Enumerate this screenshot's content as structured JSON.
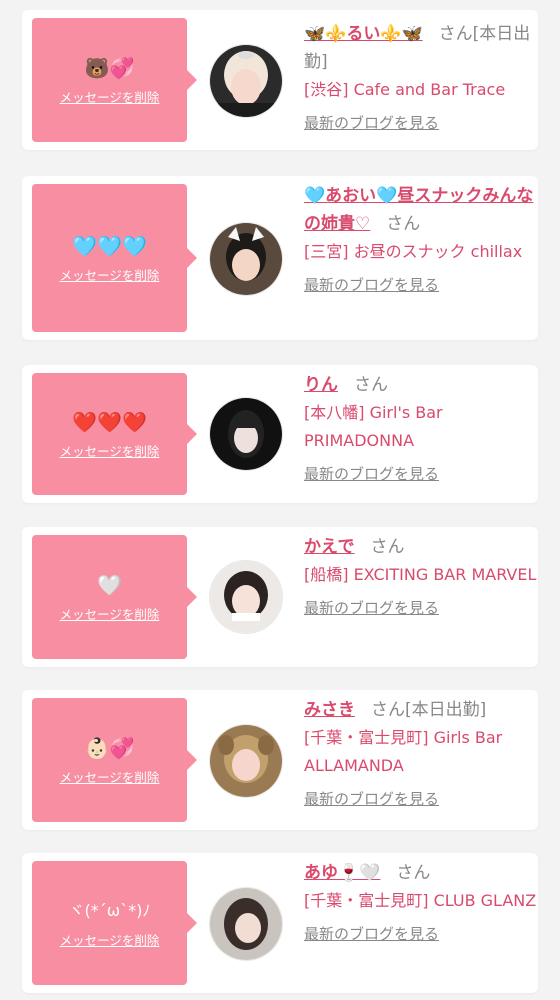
{
  "delete_label": "メッセージを削除",
  "blog_label": "最新のブログを見る",
  "cards": [
    {
      "name": "🦋⚜️るい⚜️🦋",
      "san": "さん",
      "tag": "[本日出勤]",
      "shop": "[渋谷] Cafe and Bar Trace",
      "message_emoji": "🐻💞"
    },
    {
      "name": "🩵あおい🩵昼スナックみんなの姉貴♡",
      "san": "さん",
      "tag": "",
      "shop": "[三宮] お昼のスナック chillax",
      "message_emoji": "🩵🩵🩵"
    },
    {
      "name": "りん",
      "san": "さん",
      "tag": "",
      "shop": "[本八幡] Girl's Bar PRIMADONNA",
      "message_emoji": "❤️❤️❤️"
    },
    {
      "name": "かえで",
      "san": "さん",
      "tag": "",
      "shop": "[船橋] EXCITING BAR MARVEL",
      "message_emoji": "🤍"
    },
    {
      "name": "みさき",
      "san": "さん",
      "tag": "[本日出勤]",
      "shop": "[千葉・富士見町] Girls Bar ALLAMANDA",
      "message_emoji": "👶🏻💞"
    },
    {
      "name": "あゆ🍷🤍",
      "san": "さん",
      "tag": "",
      "shop": "[千葉・富士見町] CLUB GLANZ",
      "message_emoji": "ヾ(*´ω`*)ﾉ"
    }
  ],
  "colors": {
    "accent": "#d94a6c",
    "bubble": "#f88ea2",
    "gray": "#888888"
  }
}
